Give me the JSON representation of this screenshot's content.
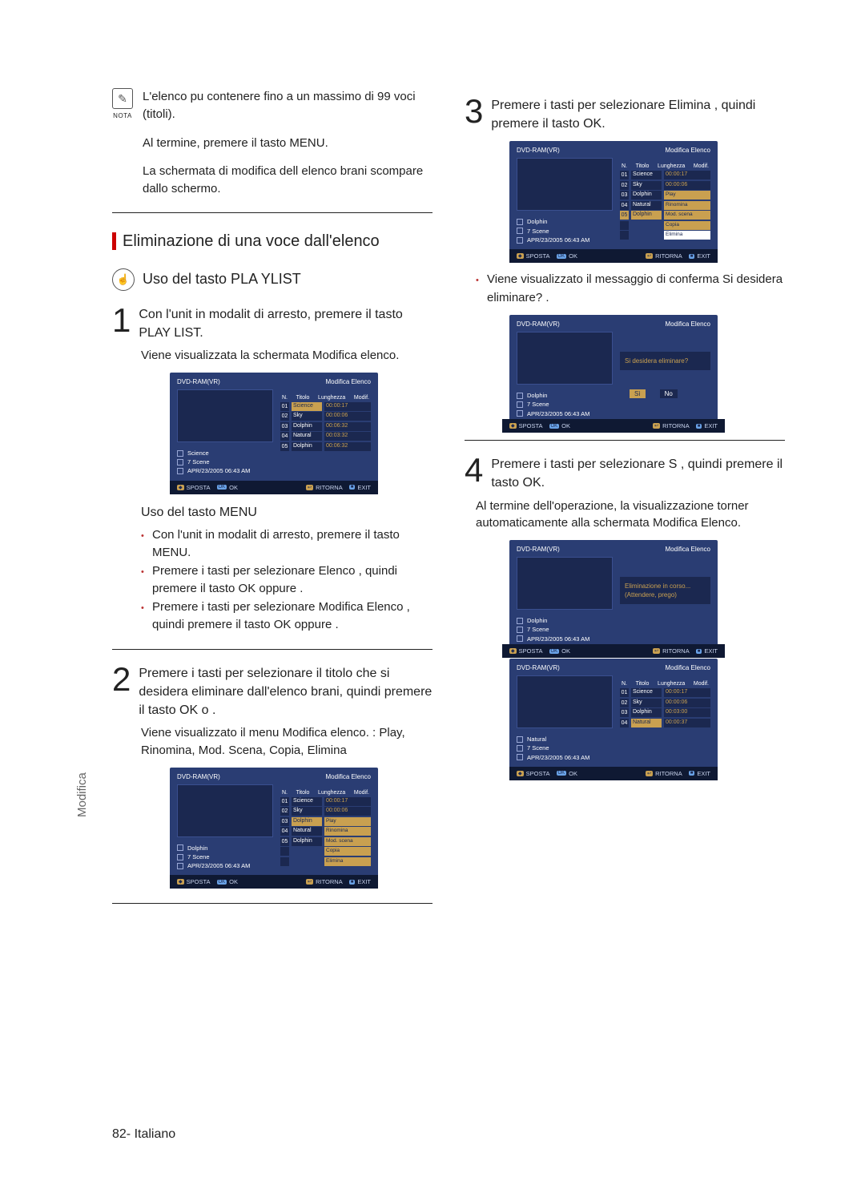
{
  "note": {
    "nota_label": "NOTA",
    "line1": "L'elenco pu   contenere fino a un massimo di 99 voci (titoli).",
    "line2": "Al termine, premere il tasto MENU.",
    "line3": "La schermata di modifica dell elenco brani scompare dallo schermo."
  },
  "section_title": "Eliminazione di una voce dall'elenco",
  "sub_title": "Uso del tasto PLA YLIST",
  "step1": {
    "num": "1",
    "text": "Con l'unit   in modalit   di arresto, premere il tasto PLAY LIST.",
    "desc": "Viene visualizzata la schermata Modifica elenco."
  },
  "uso_menu_title": "Uso del tasto MENU",
  "uso_menu": {
    "b1": "Con l'unit   in modalit   di arresto, premere il tasto MENU.",
    "b2": "Premere i tasti        per selezionare Elenco , quindi premere il tasto OK oppure     .",
    "b3": "Premere i tasti        per selezionare Modifica Elenco , quindi premere il tasto OK oppure     ."
  },
  "step2": {
    "num": "2",
    "text": "Premere i tasti        per selezionare il titolo che si desidera eliminare dall'elenco brani, quindi premere il tasto OK o    .",
    "desc": "Viene visualizzato il menu Modifica elenco. : Play, Rinomina, Mod. Scena, Copia, Elimina"
  },
  "step3": {
    "num": "3",
    "text": "Premere i tasti        per selezionare Elimina , quindi premere il tasto OK."
  },
  "step3_bullet": "Viene visualizzato il messaggio di conferma  Si desidera eliminare? .",
  "step4": {
    "num": "4",
    "text": "Premere i tasti        per selezionare S , quindi premere il tasto OK.",
    "desc": "Al termine dell'operazione, la visualizzazione torner   automaticamente alla schermata Modifica Elenco."
  },
  "panel": {
    "disc": "DVD-RAM(VR)",
    "header": "Modifica Elenco",
    "cols": {
      "n": "N.",
      "titolo": "Titolo",
      "lunghezza": "Lunghezza",
      "modif": "Modif."
    },
    "scenes_label": "7 Scene",
    "timestamp": "APR/23/2005 06:43 AM"
  },
  "panel1": {
    "title_sel": "Science",
    "rows": [
      {
        "i": "01",
        "t": "Science",
        "l": "00:00:17"
      },
      {
        "i": "02",
        "t": "Sky",
        "l": "00:00:06"
      },
      {
        "i": "03",
        "t": "Dolphin",
        "l": "00:06:32"
      },
      {
        "i": "04",
        "t": "Natural",
        "l": "00:03:32"
      },
      {
        "i": "05",
        "t": "Dolphin",
        "l": "00:06:32"
      }
    ]
  },
  "panel2": {
    "title_sel": "Dolphin",
    "rows": [
      {
        "i": "01",
        "t": "Science",
        "l": "00:00:17"
      },
      {
        "i": "02",
        "t": "Sky",
        "l": "00:00:06"
      },
      {
        "i": "03",
        "t": "Dolphin",
        "l": "Play"
      },
      {
        "i": "04",
        "t": "Natural",
        "l": "Rinomina"
      },
      {
        "i": "05",
        "t": "Dolphin",
        "l": "Mod. scena"
      }
    ],
    "extra": [
      "Copia",
      "Elimina"
    ]
  },
  "panel3": {
    "title_sel": "Dolphin",
    "rows": [
      {
        "i": "01",
        "t": "Science",
        "l": "00:00:17"
      },
      {
        "i": "02",
        "t": "Sky",
        "l": "00:00:06"
      },
      {
        "i": "03",
        "t": "Dolphin",
        "l": "Play"
      },
      {
        "i": "04",
        "t": "Natural",
        "l": "Rinomina"
      },
      {
        "i": "05",
        "t": "Dolphin",
        "l": "Mod. scena"
      }
    ],
    "extra": [
      "Copia",
      "Elimina"
    ],
    "sel_menu": "Elimina"
  },
  "panel4": {
    "title_sel": "Dolphin",
    "confirm": "Si desidera eliminare?",
    "yes": "Sì",
    "no": "No"
  },
  "panel5": {
    "title_sel": "Dolphin",
    "progress1": "Eliminazione in corso...",
    "progress2": "(Attendere, prego)"
  },
  "panel6": {
    "title_sel": "Natural",
    "rows": [
      {
        "i": "01",
        "t": "Science",
        "l": "00:00:17"
      },
      {
        "i": "02",
        "t": "Sky",
        "l": "00:00:06"
      },
      {
        "i": "03",
        "t": "Dolphin",
        "l": "00:03:00"
      },
      {
        "i": "04",
        "t": "Natural",
        "l": "00:00:37"
      }
    ]
  },
  "foot": {
    "sposta": "SPOSTA",
    "ok": "OK",
    "ritorna": "RITORNA",
    "exit": "EXIT"
  },
  "side_tab": "Modifica",
  "page_number": "82- Italiano"
}
